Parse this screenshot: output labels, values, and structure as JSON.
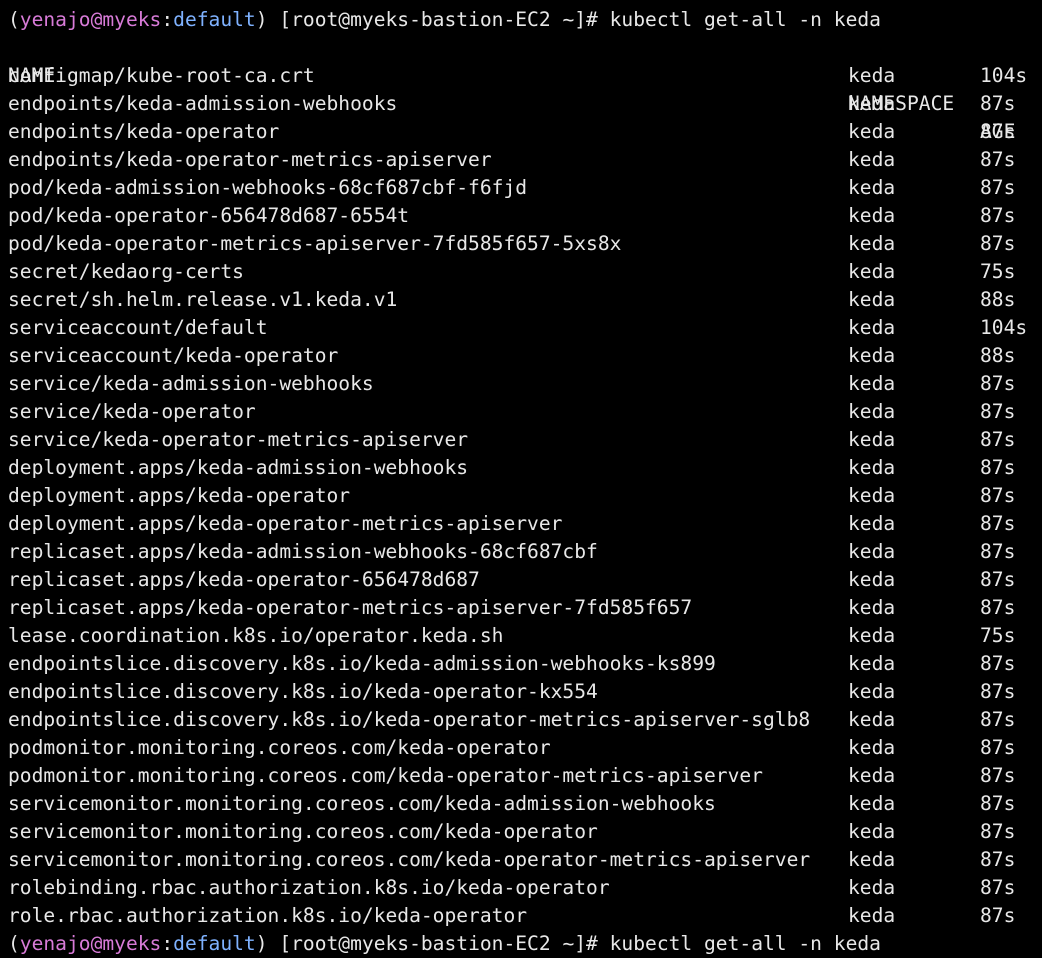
{
  "prompt": {
    "open_paren": "(",
    "user": "yenajo@myeks",
    "sep": ":",
    "context": "default",
    "close_paren": ")",
    "shell": " [root@myeks-bastion-EC2 ~]# ",
    "command": "kubectl get-all -n keda"
  },
  "next_prompt": {
    "open_paren": "(",
    "user": "yenajo@myeks",
    "sep": ":",
    "context": "default",
    "close_paren": ")",
    "shell": " [root@myeks-bastion-EC2 ~]# ",
    "command": "kubectl get-all -n keda"
  },
  "table": {
    "headers": {
      "name": "NAME",
      "namespace": "NAMESPACE",
      "age": "AGE"
    },
    "rows": [
      {
        "name": "configmap/kube-root-ca.crt",
        "namespace": "keda",
        "age": "104s"
      },
      {
        "name": "endpoints/keda-admission-webhooks",
        "namespace": "keda",
        "age": "87s"
      },
      {
        "name": "endpoints/keda-operator",
        "namespace": "keda",
        "age": "87s"
      },
      {
        "name": "endpoints/keda-operator-metrics-apiserver",
        "namespace": "keda",
        "age": "87s"
      },
      {
        "name": "pod/keda-admission-webhooks-68cf687cbf-f6fjd",
        "namespace": "keda",
        "age": "87s"
      },
      {
        "name": "pod/keda-operator-656478d687-6554t",
        "namespace": "keda",
        "age": "87s"
      },
      {
        "name": "pod/keda-operator-metrics-apiserver-7fd585f657-5xs8x",
        "namespace": "keda",
        "age": "87s"
      },
      {
        "name": "secret/kedaorg-certs",
        "namespace": "keda",
        "age": "75s"
      },
      {
        "name": "secret/sh.helm.release.v1.keda.v1",
        "namespace": "keda",
        "age": "88s"
      },
      {
        "name": "serviceaccount/default",
        "namespace": "keda",
        "age": "104s"
      },
      {
        "name": "serviceaccount/keda-operator",
        "namespace": "keda",
        "age": "88s"
      },
      {
        "name": "service/keda-admission-webhooks",
        "namespace": "keda",
        "age": "87s"
      },
      {
        "name": "service/keda-operator",
        "namespace": "keda",
        "age": "87s"
      },
      {
        "name": "service/keda-operator-metrics-apiserver",
        "namespace": "keda",
        "age": "87s"
      },
      {
        "name": "deployment.apps/keda-admission-webhooks",
        "namespace": "keda",
        "age": "87s"
      },
      {
        "name": "deployment.apps/keda-operator",
        "namespace": "keda",
        "age": "87s"
      },
      {
        "name": "deployment.apps/keda-operator-metrics-apiserver",
        "namespace": "keda",
        "age": "87s"
      },
      {
        "name": "replicaset.apps/keda-admission-webhooks-68cf687cbf",
        "namespace": "keda",
        "age": "87s"
      },
      {
        "name": "replicaset.apps/keda-operator-656478d687",
        "namespace": "keda",
        "age": "87s"
      },
      {
        "name": "replicaset.apps/keda-operator-metrics-apiserver-7fd585f657",
        "namespace": "keda",
        "age": "87s"
      },
      {
        "name": "lease.coordination.k8s.io/operator.keda.sh",
        "namespace": "keda",
        "age": "75s"
      },
      {
        "name": "endpointslice.discovery.k8s.io/keda-admission-webhooks-ks899",
        "namespace": "keda",
        "age": "87s"
      },
      {
        "name": "endpointslice.discovery.k8s.io/keda-operator-kx554",
        "namespace": "keda",
        "age": "87s"
      },
      {
        "name": "endpointslice.discovery.k8s.io/keda-operator-metrics-apiserver-sglb8",
        "namespace": "keda",
        "age": "87s"
      },
      {
        "name": "podmonitor.monitoring.coreos.com/keda-operator",
        "namespace": "keda",
        "age": "87s"
      },
      {
        "name": "podmonitor.monitoring.coreos.com/keda-operator-metrics-apiserver",
        "namespace": "keda",
        "age": "87s"
      },
      {
        "name": "servicemonitor.monitoring.coreos.com/keda-admission-webhooks",
        "namespace": "keda",
        "age": "87s"
      },
      {
        "name": "servicemonitor.monitoring.coreos.com/keda-operator",
        "namespace": "keda",
        "age": "87s"
      },
      {
        "name": "servicemonitor.monitoring.coreos.com/keda-operator-metrics-apiserver",
        "namespace": "keda",
        "age": "87s"
      },
      {
        "name": "rolebinding.rbac.authorization.k8s.io/keda-operator",
        "namespace": "keda",
        "age": "87s"
      },
      {
        "name": "role.rbac.authorization.k8s.io/keda-operator",
        "namespace": "keda",
        "age": "87s"
      }
    ]
  },
  "colors": {
    "background": "#000000",
    "text": "#e8e8e8",
    "user": "#d87bd8",
    "context": "#7fb2ff"
  }
}
